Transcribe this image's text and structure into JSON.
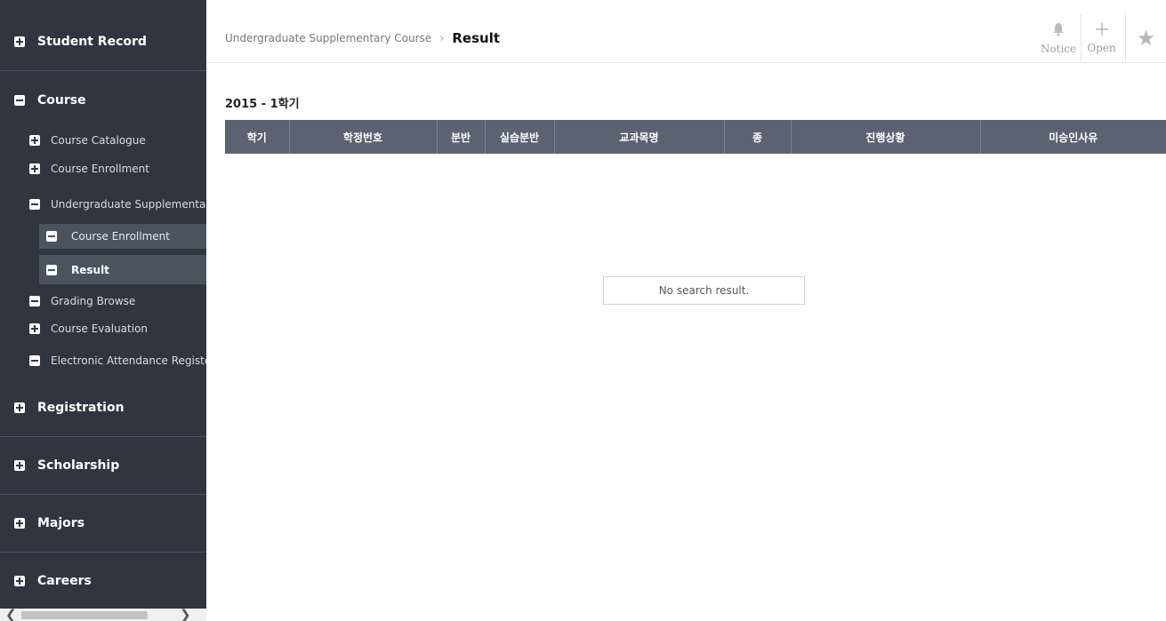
{
  "sidebar": {
    "categories": {
      "student_record": "Student Record",
      "course": "Course",
      "registration": "Registration",
      "scholarship": "Scholarship",
      "majors": "Majors",
      "careers": "Careers"
    },
    "course_items": {
      "catalogue": "Course Catalogue",
      "enrollment": "Course Enrollment",
      "undergrad_supp": "Undergraduate Supplementary",
      "supp_enrollment": "Course Enrollment",
      "supp_result": "Result",
      "grading": "Grading Browse",
      "evaluation": "Course Evaluation",
      "attendance": "Electronic Attendance Register"
    },
    "scroll_left": "❮",
    "scroll_right": "❯"
  },
  "header": {
    "breadcrumb_parent": "Undergraduate Supplementary Course",
    "breadcrumb_separator": "›",
    "breadcrumb_current": "Result",
    "notice_label": "Notice",
    "notice_icon": "bell-icon",
    "open_label": "Open",
    "open_icon": "plus-icon",
    "star_icon": "star-icon"
  },
  "main": {
    "term_title": "2015 - 1학기",
    "columns": [
      "학기",
      "학정번호",
      "분반",
      "실습분반",
      "교과목명",
      "종",
      "진행상황",
      "미승인사유"
    ],
    "empty_message": "No search result."
  }
}
